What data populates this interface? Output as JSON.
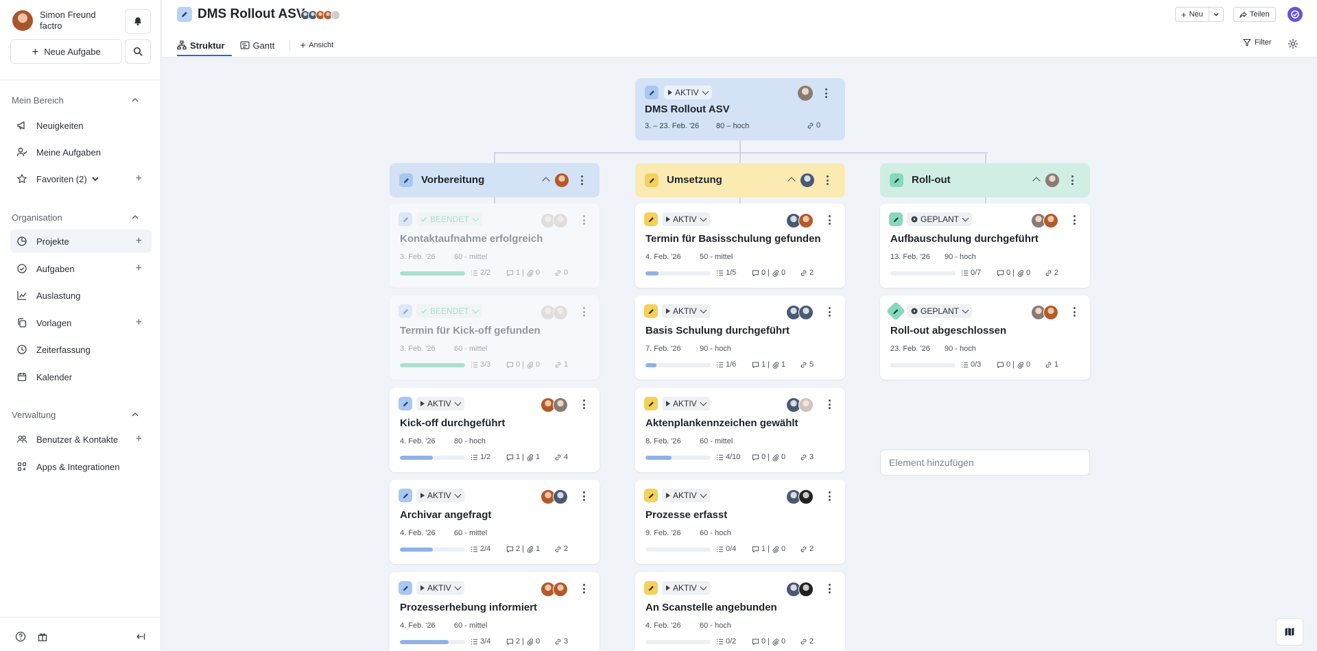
{
  "user": {
    "name": "Simon Freund",
    "org": "factro"
  },
  "sidebar": {
    "new_task": "Neue Aufgabe",
    "sections": {
      "mein": "Mein Bereich",
      "org": "Organisation",
      "verw": "Verwaltung"
    },
    "items": {
      "neuigkeiten": "Neuigkeiten",
      "meine_aufgaben": "Meine Aufgaben",
      "favoriten": "Favoriten (2)",
      "projekte": "Projekte",
      "aufgaben": "Aufgaben",
      "auslastung": "Auslastung",
      "vorlagen": "Vorlagen",
      "zeiterfassung": "Zeiterfassung",
      "kalender": "Kalender",
      "benutzer": "Benutzer & Kontakte",
      "apps": "Apps & Integrationen"
    }
  },
  "header": {
    "title": "DMS Rollout ASV",
    "new_label": "Neu",
    "share_label": "Teilen",
    "filter_label": "Filter",
    "tabs": {
      "struktur": "Struktur",
      "gantt": "Gantt",
      "ansicht": "Ansicht"
    }
  },
  "root": {
    "status": "AKTIV",
    "title": "DMS Rollout ASV",
    "date": "3. – 23. Feb. '26",
    "prio": "80 – hoch",
    "links": "0"
  },
  "columns": {
    "c1": {
      "title": "Vorbereitung",
      "color": "#d3e2f5"
    },
    "c2": {
      "title": "Umsetzung",
      "color": "#fbeab1"
    },
    "c3": {
      "title": "Roll-out",
      "color": "#d0eee4"
    }
  },
  "cards": {
    "v1": {
      "status": "BEENDET",
      "title": "Kontaktaufnahme erfolgreich",
      "date": "3. Feb. '26",
      "prio": "60 - mittel",
      "sub": "2/2",
      "cm": "1 | ",
      "att": "0",
      "links": "0",
      "progress": 1.0
    },
    "v2": {
      "status": "BEENDET",
      "title": "Termin für Kick-off gefunden",
      "date": "3. Feb. '26",
      "prio": "60 - mittel",
      "sub": "3/3",
      "cm": "0 | ",
      "att": "0",
      "links": "1",
      "progress": 1.0
    },
    "v3": {
      "status": "AKTIV",
      "title": "Kick-off durchgeführt",
      "date": "4. Feb. '26",
      "prio": "80 - hoch",
      "sub": "1/2",
      "cm": "1 | ",
      "att": "1",
      "links": "4",
      "progress": 0.5
    },
    "v4": {
      "status": "AKTIV",
      "title": "Archivar angefragt",
      "date": "4. Feb. '26",
      "prio": "60 - mittel",
      "sub": "2/4",
      "cm": "2 | ",
      "att": "1",
      "links": "2",
      "progress": 0.5
    },
    "v5": {
      "status": "AKTIV",
      "title": "Prozesserhebung informiert",
      "date": "4. Feb. '26",
      "prio": "60 - mittel",
      "sub": "3/4",
      "cm": "2 | ",
      "att": "0",
      "links": "3",
      "progress": 0.75
    },
    "u1": {
      "status": "AKTIV",
      "title": "Termin für Basisschulung gefunden",
      "date": "4. Feb. '26",
      "prio": "50 - mittel",
      "sub": "1/5",
      "cm": "0 | ",
      "att": "0",
      "links": "2",
      "progress": 0.2
    },
    "u2": {
      "status": "AKTIV",
      "title": "Basis Schulung durchgeführt",
      "date": "7. Feb. '26",
      "prio": "90 - hoch",
      "sub": "1/6",
      "cm": "1 | ",
      "att": "1",
      "links": "5",
      "progress": 0.17
    },
    "u3": {
      "status": "AKTIV",
      "title": "Aktenplankennzeichen gewählt",
      "date": "8. Feb. '26",
      "prio": "60 - mittel",
      "sub": "4/10",
      "cm": "0 | ",
      "att": "0",
      "links": "3",
      "progress": 0.4
    },
    "u4": {
      "status": "AKTIV",
      "title": "Prozesse erfasst",
      "date": "9. Feb. '26",
      "prio": "60 - hoch",
      "sub": "0/4",
      "cm": "1 | ",
      "att": "0",
      "links": "2",
      "progress": 0.0
    },
    "u5": {
      "status": "AKTIV",
      "title": "An Scanstelle angebunden",
      "date": "4. Feb. '26",
      "prio": "60 - hoch",
      "sub": "0/2",
      "cm": "0 | ",
      "att": "0",
      "links": "2",
      "progress": 0.0
    },
    "r1": {
      "status": "GEPLANT",
      "title": "Aufbauschulung durchgeführt",
      "date": "13. Feb. '26",
      "prio": "90 - hoch",
      "sub": "0/7",
      "cm": "0 | ",
      "att": "0",
      "links": "2",
      "progress": 0.0
    },
    "r2": {
      "status": "GEPLANT",
      "title": "Roll-out abgeschlossen",
      "date": "23. Feb. '26",
      "prio": "90 - hoch",
      "sub": "0/3",
      "cm": "0 | ",
      "att": "0",
      "links": "1",
      "progress": 0.0
    }
  },
  "add_element": "Element hinzufügen",
  "colors": {
    "accent": "#2f63c7",
    "done_green": "#5cc59d",
    "progress_blue": "#8fb2e6",
    "logo": "#6a53d8"
  },
  "icons": {
    "notification": "bell-icon",
    "search": "search-icon",
    "edit": "pencil-icon",
    "map": "map-icon",
    "settings": "gear-icon"
  }
}
